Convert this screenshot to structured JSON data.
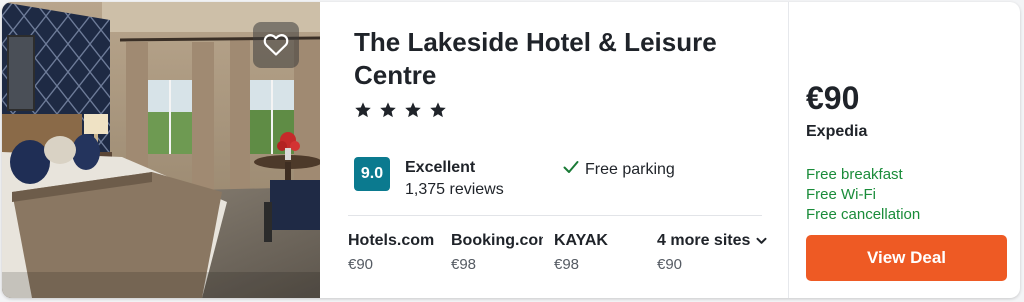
{
  "hotel": {
    "name": "The Lakeside Hotel & Leisure Centre",
    "star_rating": 4,
    "favorite_icon": "heart-outline-icon"
  },
  "rating": {
    "score": "9.0",
    "label": "Excellent",
    "reviews": "1,375 reviews",
    "badge_color": "#0b7a8f"
  },
  "amenity": {
    "icon": "check-icon",
    "label": "Free parking"
  },
  "providers": [
    {
      "name": "Hotels.com",
      "price": "€90"
    },
    {
      "name": "Booking.com",
      "price": "€98"
    },
    {
      "name": "KAYAK",
      "price": "€98"
    },
    {
      "name": "4 more sites",
      "price": "€90",
      "icon": "chevron-down-icon"
    }
  ],
  "deal": {
    "price": "€90",
    "site": "Expedia",
    "perks": [
      "Free breakfast",
      "Free Wi-Fi",
      "Free cancellation"
    ],
    "button_label": "View Deal",
    "button_color": "#ee5a24",
    "perk_color": "#1a8c3a"
  }
}
